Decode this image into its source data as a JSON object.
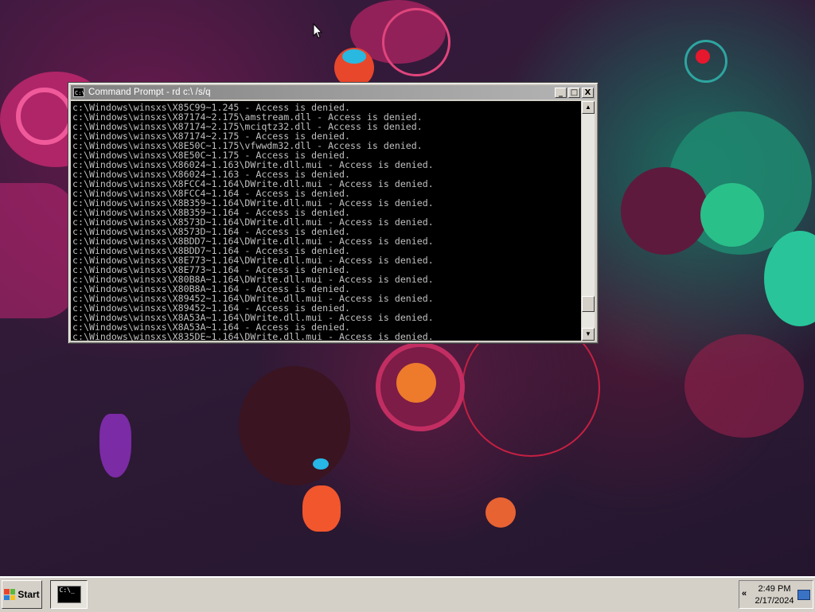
{
  "window": {
    "title": "Command Prompt - rd  c:\\ /s/q",
    "icon": "console-icon",
    "icon_glyph": "C:\\",
    "minimize_glyph": "_",
    "maximize_glyph": "□",
    "close_glyph": "X"
  },
  "console": {
    "text": "c:\\Windows\\winsxs\\X85C99~1.245 - Access is denied.\nc:\\Windows\\winsxs\\X87174~2.175\\amstream.dll - Access is denied.\nc:\\Windows\\winsxs\\X87174~2.175\\mciqtz32.dll - Access is denied.\nc:\\Windows\\winsxs\\X87174~2.175 - Access is denied.\nc:\\Windows\\winsxs\\X8E50C~1.175\\vfwwdm32.dll - Access is denied.\nc:\\Windows\\winsxs\\X8E50C~1.175 - Access is denied.\nc:\\Windows\\winsxs\\X86024~1.163\\DWrite.dll.mui - Access is denied.\nc:\\Windows\\winsxs\\X86024~1.163 - Access is denied.\nc:\\Windows\\winsxs\\X8FCC4~1.164\\DWrite.dll.mui - Access is denied.\nc:\\Windows\\winsxs\\X8FCC4~1.164 - Access is denied.\nc:\\Windows\\winsxs\\X8B359~1.164\\DWrite.dll.mui - Access is denied.\nc:\\Windows\\winsxs\\X8B359~1.164 - Access is denied.\nc:\\Windows\\winsxs\\X8573D~1.164\\DWrite.dll.mui - Access is denied.\nc:\\Windows\\winsxs\\X8573D~1.164 - Access is denied.\nc:\\Windows\\winsxs\\X8BDD7~1.164\\DWrite.dll.mui - Access is denied.\nc:\\Windows\\winsxs\\X8BDD7~1.164 - Access is denied.\nc:\\Windows\\winsxs\\X8E773~1.164\\DWrite.dll.mui - Access is denied.\nc:\\Windows\\winsxs\\X8E773~1.164 - Access is denied.\nc:\\Windows\\winsxs\\X80B8A~1.164\\DWrite.dll.mui - Access is denied.\nc:\\Windows\\winsxs\\X80B8A~1.164 - Access is denied.\nc:\\Windows\\winsxs\\X89452~1.164\\DWrite.dll.mui - Access is denied.\nc:\\Windows\\winsxs\\X89452~1.164 - Access is denied.\nc:\\Windows\\winsxs\\X8A53A~1.164\\DWrite.dll.mui - Access is denied.\nc:\\Windows\\winsxs\\X8A53A~1.164 - Access is denied.\nc:\\Windows\\winsxs\\X835DE~1.164\\DWrite.dll.mui - Access is denied.",
    "scroll_position": 0.92
  },
  "scrollbar": {
    "up_glyph": "▲",
    "down_glyph": "▼"
  },
  "taskbar": {
    "start_label": "Start",
    "start_icon": "windows-logo-icon",
    "task_button_icon": "command-prompt-icon",
    "task_icon_glyph": "C:\\_",
    "tray_expand_glyph": "«",
    "time": "2:49 PM",
    "date": "2/17/2024",
    "network_icon": "network-icon"
  },
  "colors": {
    "console_bg": "#000000",
    "console_text": "#c0c0c0",
    "titlebar_inactive": "#808080",
    "window_face": "#d4d0c8"
  }
}
